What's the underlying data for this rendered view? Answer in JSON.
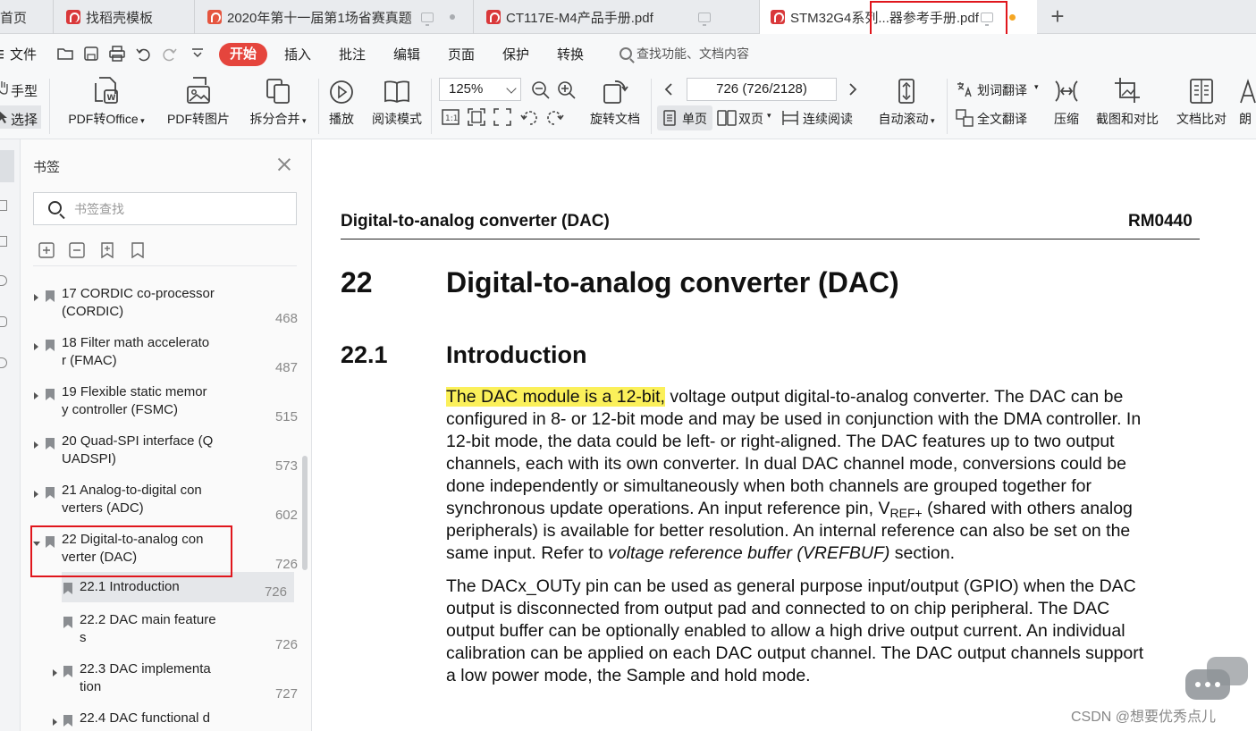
{
  "tabs": [
    {
      "label": "首页"
    },
    {
      "label": "找稻壳模板"
    },
    {
      "label": "2020年第十一届第1场省赛真题"
    },
    {
      "label": "CT117E-M4产品手册.pdf"
    },
    {
      "label": "STM32G4系列...器参考手册.pdf"
    }
  ],
  "menu": {
    "file": "文件",
    "start": "开始",
    "insert": "插入",
    "annotate": "批注",
    "edit": "编辑",
    "page": "页面",
    "protect": "保护",
    "convert": "转换",
    "search_func": "查找功能、文档内容"
  },
  "ribbon": {
    "hand": "手型",
    "select": "选择",
    "pdf_to_office": "PDF转Office",
    "pdf_to_image": "PDF转图片",
    "split_merge": "拆分合并",
    "play": "播放",
    "read_mode": "阅读模式",
    "zoom": "125%",
    "rotate_doc": "旋转文档",
    "page_field": "726 (726/2128)",
    "single_page": "单页",
    "double_page": "双页",
    "continuous": "连续阅读",
    "auto_scroll": "自动滚动",
    "word_translate": "划词翻译",
    "full_translate": "全文翻译",
    "compress": "压缩",
    "screenshot_compare": "截图和对比",
    "doc_compare": "文档比对",
    "read_aloud": "朗"
  },
  "bookmarks": {
    "title": "书签",
    "search_placeholder": "书签查找",
    "items": [
      {
        "line1": "17 CORDIC co-processor",
        "line2": "(CORDIC)",
        "page": "468"
      },
      {
        "line1": "18 Filter math accelerato",
        "line2": "r (FMAC)",
        "page": "487"
      },
      {
        "line1": "19 Flexible static memor",
        "line2": "y controller (FSMC)",
        "page": "515"
      },
      {
        "line1": "20 Quad-SPI interface (Q",
        "line2": "UADSPI)",
        "page": "573"
      },
      {
        "line1": "21 Analog-to-digital con",
        "line2": "verters (ADC)",
        "page": "602"
      },
      {
        "line1": "22 Digital-to-analog con",
        "line2": "verter (DAC)",
        "page": "726"
      },
      {
        "line1": "22.1 Introduction",
        "line2": "",
        "page": "726"
      },
      {
        "line1": "22.2 DAC main feature",
        "line2": "s",
        "page": "726"
      },
      {
        "line1": "22.3 DAC implementa",
        "line2": "tion",
        "page": "727"
      },
      {
        "line1": "22.4 DAC functional d",
        "line2": "",
        "page": ""
      }
    ]
  },
  "document": {
    "header_left": "Digital-to-analog converter (DAC)",
    "header_right": "RM0440",
    "chapter_num": "22",
    "chapter_title": "Digital-to-analog converter (DAC)",
    "section_num": "22.1",
    "section_title": "Introduction",
    "p1_highlight": "The DAC module is a 12-bit,",
    "p1_l1": " voltage output digital-to-analog converter. The DAC can be",
    "p1_l2": "configured in 8- or 12-bit mode and may be used in conjunction with the DMA controller. In",
    "p1_l3": "12-bit mode, the data could be left- or right-aligned. The DAC features up to two output",
    "p1_l4": "channels, each with its own converter. In dual DAC channel mode, conversions could be",
    "p1_l5": "done independently or simultaneously when both channels are grouped together for",
    "p1_l6a": "synchronous update operations. An input reference pin, V",
    "p1_l6sub": "REF+",
    "p1_l6b": " (shared with others analog",
    "p1_l7": "peripherals) is available for better resolution. An internal reference can also be set on the",
    "p1_l8a": "same input. Refer to ",
    "p1_l8it": "voltage reference buffer (VREFBUF)",
    "p1_l8b": " section.",
    "p2_l1": "The DACx_OUTy pin can be used as general purpose input/output (GPIO) when the DAC",
    "p2_l2": "output is disconnected from output pad and connected to on chip peripheral. The DAC",
    "p2_l3": "output buffer can be optionally enabled to allow a high drive output current. An individual",
    "p2_l4": "calibration can be applied on each DAC output channel. The DAC output channels support",
    "p2_l5": "a low power mode, the Sample and hold mode."
  },
  "watermark": "CSDN @想要优秀点儿",
  "colors": {
    "accent_red": "#e5453d",
    "highlight_yellow": "#fbf05a",
    "annotation_box": "#e0161c"
  }
}
